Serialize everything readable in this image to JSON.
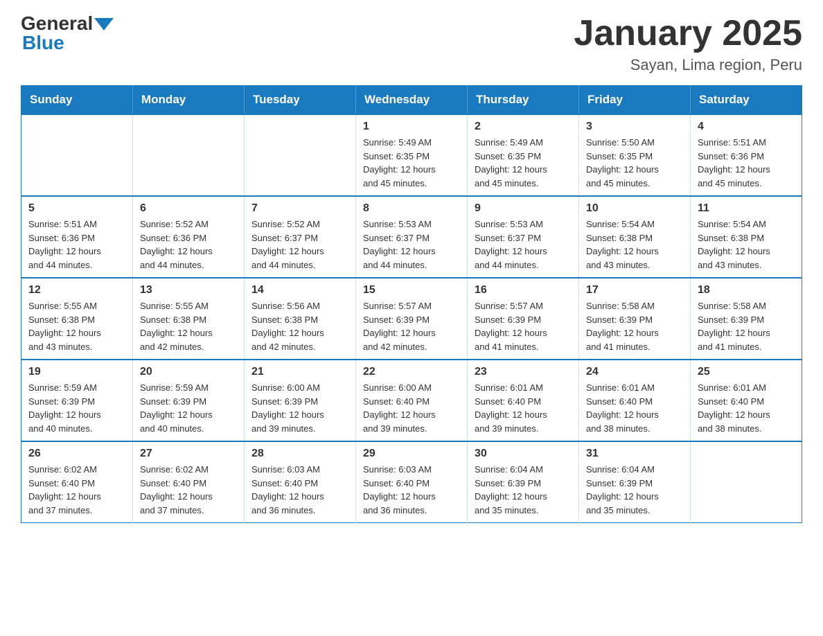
{
  "header": {
    "logo_general": "General",
    "logo_blue": "Blue",
    "title": "January 2025",
    "subtitle": "Sayan, Lima region, Peru"
  },
  "calendar": {
    "days_of_week": [
      "Sunday",
      "Monday",
      "Tuesday",
      "Wednesday",
      "Thursday",
      "Friday",
      "Saturday"
    ],
    "weeks": [
      [
        {
          "day": "",
          "info": ""
        },
        {
          "day": "",
          "info": ""
        },
        {
          "day": "",
          "info": ""
        },
        {
          "day": "1",
          "info": "Sunrise: 5:49 AM\nSunset: 6:35 PM\nDaylight: 12 hours\nand 45 minutes."
        },
        {
          "day": "2",
          "info": "Sunrise: 5:49 AM\nSunset: 6:35 PM\nDaylight: 12 hours\nand 45 minutes."
        },
        {
          "day": "3",
          "info": "Sunrise: 5:50 AM\nSunset: 6:35 PM\nDaylight: 12 hours\nand 45 minutes."
        },
        {
          "day": "4",
          "info": "Sunrise: 5:51 AM\nSunset: 6:36 PM\nDaylight: 12 hours\nand 45 minutes."
        }
      ],
      [
        {
          "day": "5",
          "info": "Sunrise: 5:51 AM\nSunset: 6:36 PM\nDaylight: 12 hours\nand 44 minutes."
        },
        {
          "day": "6",
          "info": "Sunrise: 5:52 AM\nSunset: 6:36 PM\nDaylight: 12 hours\nand 44 minutes."
        },
        {
          "day": "7",
          "info": "Sunrise: 5:52 AM\nSunset: 6:37 PM\nDaylight: 12 hours\nand 44 minutes."
        },
        {
          "day": "8",
          "info": "Sunrise: 5:53 AM\nSunset: 6:37 PM\nDaylight: 12 hours\nand 44 minutes."
        },
        {
          "day": "9",
          "info": "Sunrise: 5:53 AM\nSunset: 6:37 PM\nDaylight: 12 hours\nand 44 minutes."
        },
        {
          "day": "10",
          "info": "Sunrise: 5:54 AM\nSunset: 6:38 PM\nDaylight: 12 hours\nand 43 minutes."
        },
        {
          "day": "11",
          "info": "Sunrise: 5:54 AM\nSunset: 6:38 PM\nDaylight: 12 hours\nand 43 minutes."
        }
      ],
      [
        {
          "day": "12",
          "info": "Sunrise: 5:55 AM\nSunset: 6:38 PM\nDaylight: 12 hours\nand 43 minutes."
        },
        {
          "day": "13",
          "info": "Sunrise: 5:55 AM\nSunset: 6:38 PM\nDaylight: 12 hours\nand 42 minutes."
        },
        {
          "day": "14",
          "info": "Sunrise: 5:56 AM\nSunset: 6:38 PM\nDaylight: 12 hours\nand 42 minutes."
        },
        {
          "day": "15",
          "info": "Sunrise: 5:57 AM\nSunset: 6:39 PM\nDaylight: 12 hours\nand 42 minutes."
        },
        {
          "day": "16",
          "info": "Sunrise: 5:57 AM\nSunset: 6:39 PM\nDaylight: 12 hours\nand 41 minutes."
        },
        {
          "day": "17",
          "info": "Sunrise: 5:58 AM\nSunset: 6:39 PM\nDaylight: 12 hours\nand 41 minutes."
        },
        {
          "day": "18",
          "info": "Sunrise: 5:58 AM\nSunset: 6:39 PM\nDaylight: 12 hours\nand 41 minutes."
        }
      ],
      [
        {
          "day": "19",
          "info": "Sunrise: 5:59 AM\nSunset: 6:39 PM\nDaylight: 12 hours\nand 40 minutes."
        },
        {
          "day": "20",
          "info": "Sunrise: 5:59 AM\nSunset: 6:39 PM\nDaylight: 12 hours\nand 40 minutes."
        },
        {
          "day": "21",
          "info": "Sunrise: 6:00 AM\nSunset: 6:39 PM\nDaylight: 12 hours\nand 39 minutes."
        },
        {
          "day": "22",
          "info": "Sunrise: 6:00 AM\nSunset: 6:40 PM\nDaylight: 12 hours\nand 39 minutes."
        },
        {
          "day": "23",
          "info": "Sunrise: 6:01 AM\nSunset: 6:40 PM\nDaylight: 12 hours\nand 39 minutes."
        },
        {
          "day": "24",
          "info": "Sunrise: 6:01 AM\nSunset: 6:40 PM\nDaylight: 12 hours\nand 38 minutes."
        },
        {
          "day": "25",
          "info": "Sunrise: 6:01 AM\nSunset: 6:40 PM\nDaylight: 12 hours\nand 38 minutes."
        }
      ],
      [
        {
          "day": "26",
          "info": "Sunrise: 6:02 AM\nSunset: 6:40 PM\nDaylight: 12 hours\nand 37 minutes."
        },
        {
          "day": "27",
          "info": "Sunrise: 6:02 AM\nSunset: 6:40 PM\nDaylight: 12 hours\nand 37 minutes."
        },
        {
          "day": "28",
          "info": "Sunrise: 6:03 AM\nSunset: 6:40 PM\nDaylight: 12 hours\nand 36 minutes."
        },
        {
          "day": "29",
          "info": "Sunrise: 6:03 AM\nSunset: 6:40 PM\nDaylight: 12 hours\nand 36 minutes."
        },
        {
          "day": "30",
          "info": "Sunrise: 6:04 AM\nSunset: 6:39 PM\nDaylight: 12 hours\nand 35 minutes."
        },
        {
          "day": "31",
          "info": "Sunrise: 6:04 AM\nSunset: 6:39 PM\nDaylight: 12 hours\nand 35 minutes."
        },
        {
          "day": "",
          "info": ""
        }
      ]
    ]
  }
}
